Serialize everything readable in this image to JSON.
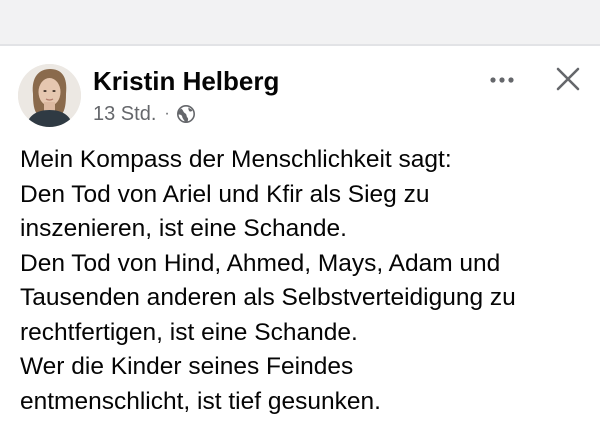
{
  "post": {
    "author": "Kristin Helberg",
    "timestamp": "13 Std.",
    "separator": "·",
    "privacy_icon": "globe-icon",
    "actions": {
      "more_icon": "more-horizontal-icon",
      "close_icon": "close-icon"
    },
    "lines": [
      "Mein Kompass der Menschlichkeit sagt:",
      "Den Tod von Ariel und Kfir als Sieg zu",
      "inszenieren, ist eine Schande.",
      "Den Tod von Hind, Ahmed, Mays, Adam und",
      "Tausenden anderen als Selbstverteidigung zu",
      "rechtfertigen, ist eine Schande.",
      "Wer die Kinder seines Feindes",
      "entmenschlicht, ist tief gesunken."
    ]
  },
  "colors": {
    "text_primary": "#050505",
    "text_secondary": "#65676b",
    "top_band": "#f2f2f3",
    "divider": "#e2e3e6"
  }
}
